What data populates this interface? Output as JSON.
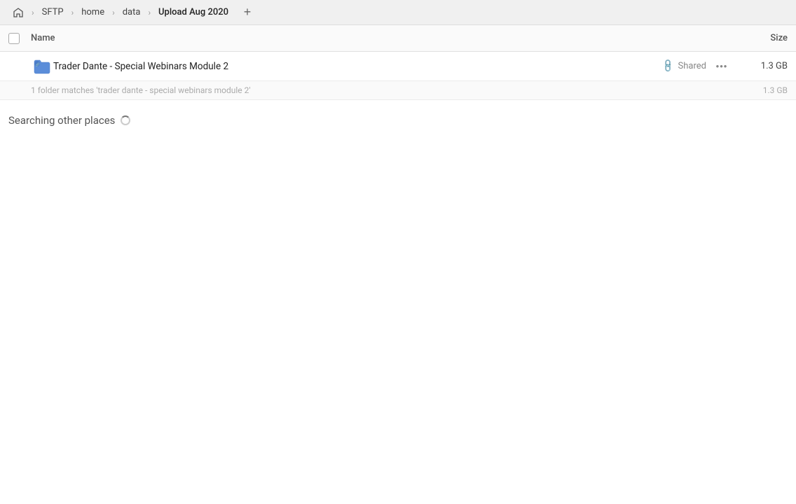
{
  "header": {
    "home_icon": "🏠",
    "breadcrumbs": [
      {
        "label": "SFTP",
        "active": false
      },
      {
        "label": "home",
        "active": false
      },
      {
        "label": "data",
        "active": false
      },
      {
        "label": "Upload Aug 2020",
        "active": true
      }
    ],
    "add_tab_label": "+"
  },
  "table": {
    "col_name_label": "Name",
    "col_size_label": "Size"
  },
  "file_row": {
    "name": "Trader Dante - Special Webinars Module 2",
    "size": "1.3 GB",
    "shared_label": "Shared",
    "more_icon": "···"
  },
  "match_info": {
    "text": "1 folder matches 'trader dante - special webinars module 2'",
    "size": "1.3 GB"
  },
  "searching_section": {
    "title": "Searching other places"
  }
}
